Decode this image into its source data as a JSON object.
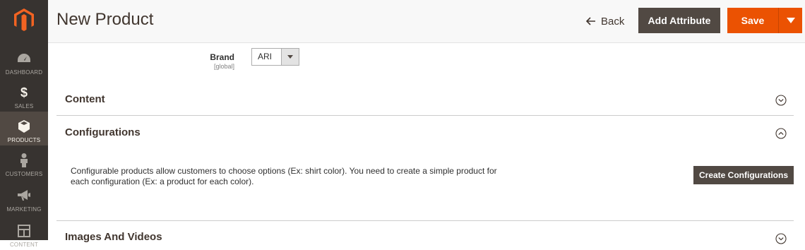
{
  "sidebar": {
    "items": [
      {
        "label": "DASHBOARD",
        "icon": "gauge-icon"
      },
      {
        "label": "SALES",
        "icon": "dollar-icon"
      },
      {
        "label": "PRODUCTS",
        "icon": "box-icon"
      },
      {
        "label": "CUSTOMERS",
        "icon": "person-icon"
      },
      {
        "label": "MARKETING",
        "icon": "megaphone-icon"
      },
      {
        "label": "CONTENT",
        "icon": "layout-icon"
      }
    ]
  },
  "header": {
    "title": "New Product",
    "back_label": "Back",
    "add_attribute_label": "Add Attribute",
    "save_label": "Save"
  },
  "brand": {
    "label": "Brand",
    "scope": "[global]",
    "value": "ARI"
  },
  "sections": {
    "content": {
      "title": "Content"
    },
    "configurations": {
      "title": "Configurations",
      "description": "Configurable products allow customers to choose options (Ex: shirt color). You need to create a simple product for each configuration (Ex: a product for each color).",
      "button_label": "Create Configurations"
    },
    "images": {
      "title": "Images And Videos"
    }
  },
  "colors": {
    "sidebar_bg": "#373330",
    "sidebar_active": "#514943",
    "brand_orange": "#eb5202",
    "dark_button": "#514943"
  }
}
